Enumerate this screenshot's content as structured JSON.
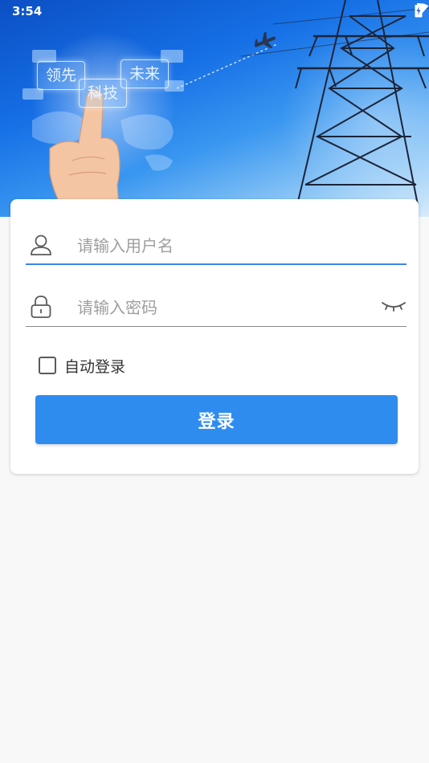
{
  "status_bar": {
    "time": "3:54"
  },
  "banner": {
    "bubbles": [
      "领先",
      "科技",
      "未来"
    ]
  },
  "form": {
    "username_placeholder": "请输入用户名",
    "password_placeholder": "请输入密码",
    "auto_login_label": "自动登录",
    "login_button": "登录"
  },
  "icons": [
    "person-icon",
    "lock-icon",
    "eye-closed-icon",
    "wifi-icon",
    "battery-icon"
  ],
  "colors": {
    "accent": "#2e8cef",
    "focus_line": "#3d83e6",
    "banner_blue": "#1670e6"
  }
}
